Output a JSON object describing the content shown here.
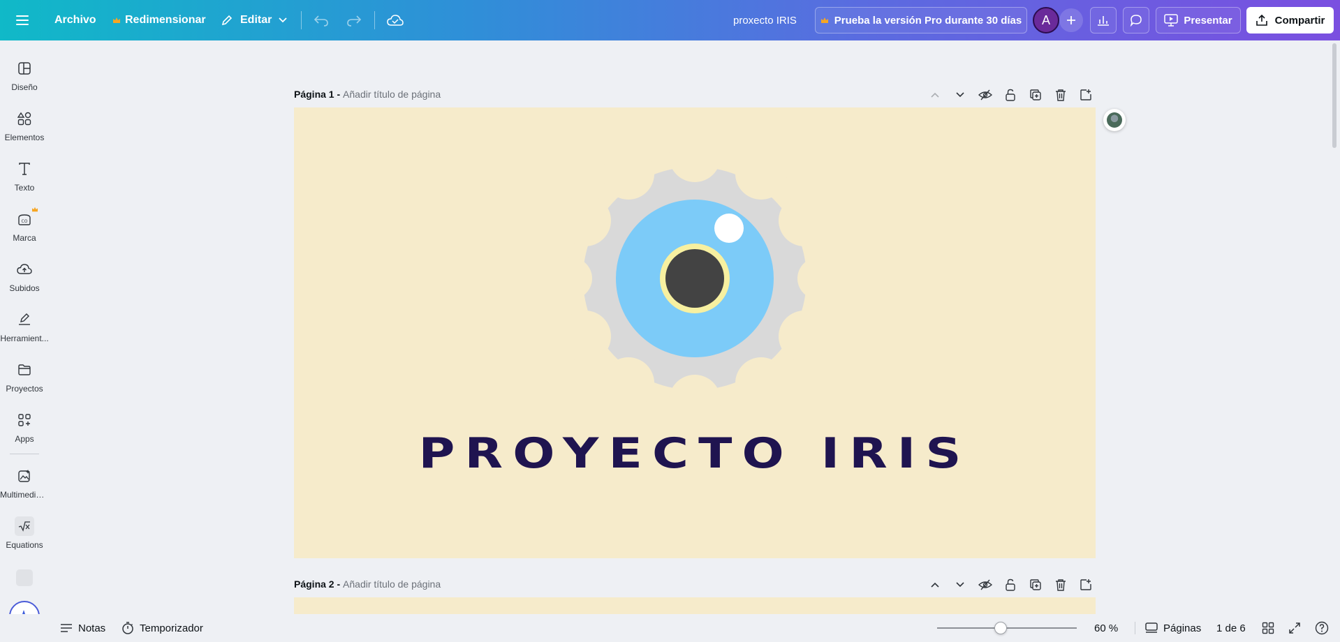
{
  "topbar": {
    "menu_icon": "hamburger-icon",
    "file_label": "Archivo",
    "resize_label": "Redimensionar",
    "edit_label": "Editar",
    "doc_title": "proxecto IRIS",
    "pro_trial_label": "Prueba la versión Pro durante 30 días",
    "avatar_initial": "A",
    "present_label": "Presentar",
    "share_label": "Compartir",
    "brand_gradient": [
      "#10b9c8",
      "#7a4fe0"
    ],
    "crown_color": "#f6a623"
  },
  "sidebar": {
    "items": [
      {
        "label": "Diseño",
        "icon": "layout-icon"
      },
      {
        "label": "Elementos",
        "icon": "shapes-icon"
      },
      {
        "label": "Texto",
        "icon": "text-icon"
      },
      {
        "label": "Marca",
        "icon": "brand-icon"
      },
      {
        "label": "Subidos",
        "icon": "cloud-upload-icon"
      },
      {
        "label": "Herramient...",
        "icon": "draw-tool-icon"
      },
      {
        "label": "Proyectos",
        "icon": "folder-icon"
      },
      {
        "label": "Apps",
        "icon": "apps-grid-icon"
      },
      {
        "label": "Multimedia ...",
        "icon": "media-icon"
      },
      {
        "label": "Equations",
        "icon": "sqrt-icon"
      }
    ]
  },
  "pages": [
    {
      "prefix": "Página 1 - ",
      "placeholder": "Añadir título de página"
    },
    {
      "prefix": "Página 2 - ",
      "placeholder": "Añadir título de página"
    }
  ],
  "canvas": {
    "title_text": "PROYECTO IRIS",
    "background": "#f6ebcb",
    "title_color": "#1f1450",
    "gear_color": "#d9d9d9",
    "iris_color": "#7ccbf8",
    "pupil_color": "#434343",
    "ring_color": "#f7f0a0"
  },
  "bottombar": {
    "notes_label": "Notas",
    "timer_label": "Temporizador",
    "zoom_value": "60 %",
    "zoom_level": 0.6,
    "pages_label": "Páginas",
    "page_counter": "1 de 6"
  }
}
